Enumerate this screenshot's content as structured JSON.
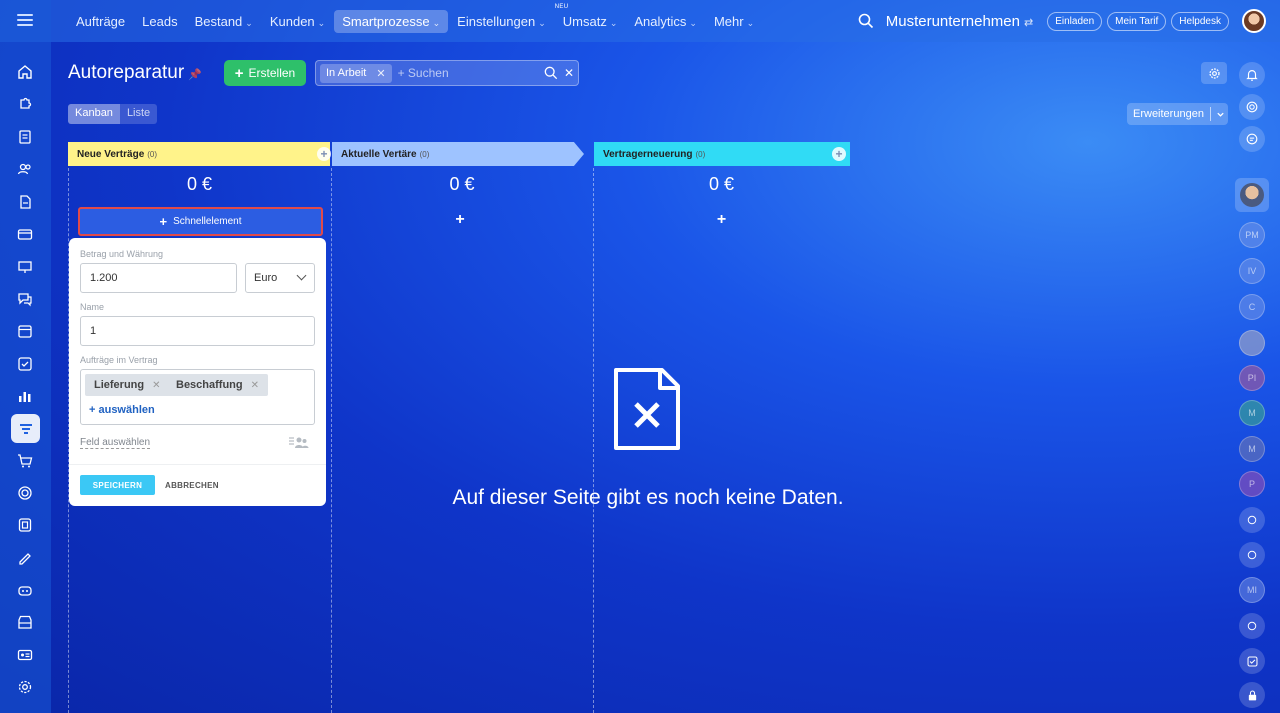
{
  "nav": {
    "items": [
      {
        "label": "Aufträge",
        "chevron": false,
        "active": false,
        "badge": ""
      },
      {
        "label": "Leads",
        "chevron": false,
        "active": false,
        "badge": ""
      },
      {
        "label": "Bestand",
        "chevron": true,
        "active": false,
        "badge": ""
      },
      {
        "label": "Kunden",
        "chevron": true,
        "active": false,
        "badge": ""
      },
      {
        "label": "Smartprozesse",
        "chevron": true,
        "active": true,
        "badge": ""
      },
      {
        "label": "Einstellungen",
        "chevron": true,
        "active": false,
        "badge": ""
      },
      {
        "label": "Umsatz",
        "chevron": true,
        "active": false,
        "badge": "NEU"
      },
      {
        "label": "Analytics",
        "chevron": true,
        "active": false,
        "badge": ""
      },
      {
        "label": "Mehr",
        "chevron": true,
        "active": false,
        "badge": ""
      }
    ]
  },
  "header": {
    "company": "Musterunternehmen",
    "invite": "Einladen",
    "plan": "Mein Tarif",
    "helpdesk": "Helpdesk"
  },
  "page": {
    "title": "Autoreparatur",
    "create_label": "Erstellen",
    "filter_tag": "In Arbeit",
    "search_placeholder": "+ Suchen",
    "view_kanban": "Kanban",
    "view_list": "Liste",
    "extensions": "Erweiterungen"
  },
  "columns": [
    {
      "title": "Neue Verträge",
      "count": "(0)",
      "sum": "0 €",
      "color": "#fff38a"
    },
    {
      "title": "Aktuelle Vertäre",
      "count": "(0)",
      "sum": "0 €",
      "color": "#9ec3ff"
    },
    {
      "title": "Vertragerneuerung",
      "count": "(0)",
      "sum": "0 €",
      "color": "#30dbf5"
    }
  ],
  "quick_element": "Schnellelement",
  "form": {
    "amount_label": "Betrag und Währung",
    "amount_value": "1.200",
    "currency": "Euro",
    "name_label": "Name",
    "name_value": "1",
    "orders_label": "Aufträge im Vertrag",
    "tags": [
      "Lieferung",
      "Beschaffung"
    ],
    "add_link": "+ auswählen",
    "field_link": "Feld auswählen",
    "save": "SPEICHERN",
    "cancel": "ABBRECHEN"
  },
  "empty_state": "Auf dieser Seite gibt es noch keine Daten.",
  "rightbar": {
    "initials": [
      "PM",
      "IV",
      "C",
      "PI",
      "M",
      "M",
      "P",
      "MI"
    ]
  }
}
